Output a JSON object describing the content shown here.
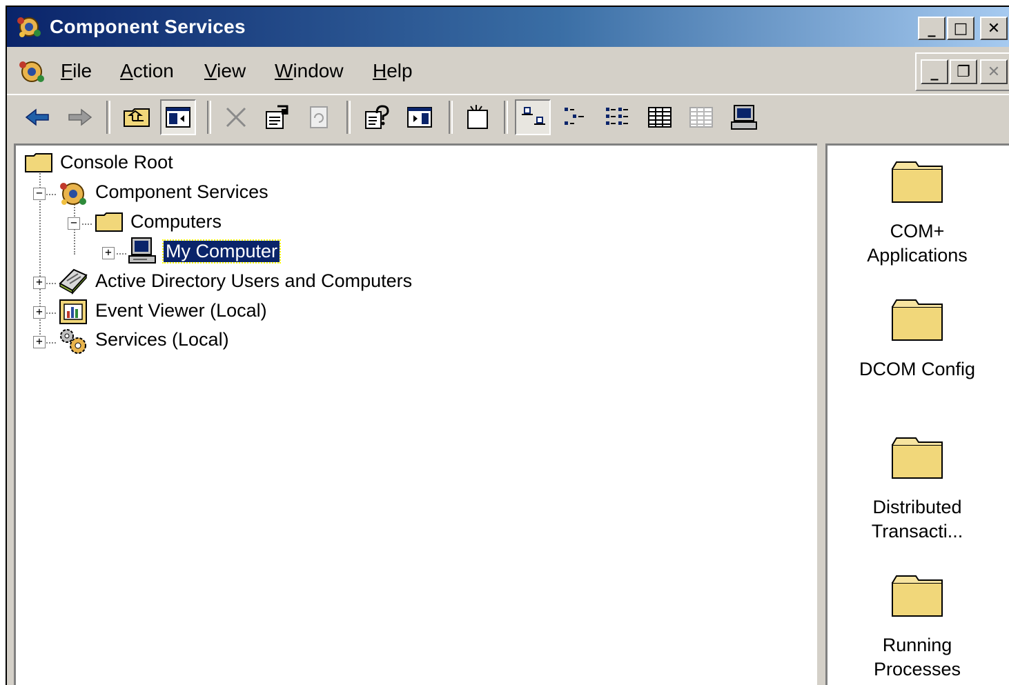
{
  "window": {
    "title": "Component Services"
  },
  "caption_buttons": {
    "minimize": "_",
    "maximize": "□",
    "close": "✕"
  },
  "menu": {
    "items": [
      {
        "label_ul": "F",
        "label_rest": "ile"
      },
      {
        "label_ul": "A",
        "label_rest": "ction"
      },
      {
        "label_ul": "V",
        "label_rest": "iew"
      },
      {
        "label_ul": "W",
        "label_rest": "indow"
      },
      {
        "label_ul": "H",
        "label_rest": "elp"
      }
    ]
  },
  "mdi_buttons": {
    "minimize": "_",
    "restore": "❐",
    "close": "✕"
  },
  "toolbar": {
    "buttons": [
      "back-icon",
      "forward-icon",
      "up-one-level-icon",
      "show-hide-tree-icon",
      "delete-icon",
      "properties-icon",
      "refresh-icon",
      "help-icon",
      "show-hide-action-pane-icon",
      "new-window-icon",
      "large-icons-view-icon",
      "small-icons-view-icon",
      "list-view-icon",
      "detail-view-icon",
      "disabled-view-icon",
      "my-computer-icon"
    ]
  },
  "tree": {
    "root": "Console Root",
    "component_services": "Component Services",
    "computers": "Computers",
    "my_computer": "My Computer",
    "active_directory": "Active Directory Users and Computers",
    "event_viewer": "Event Viewer (Local)",
    "services": "Services (Local)"
  },
  "results": {
    "items": [
      {
        "line1": "COM+",
        "line2": "Applications"
      },
      {
        "line1": "DCOM Config",
        "line2": ""
      },
      {
        "line1": "Distributed",
        "line2": "Transacti..."
      },
      {
        "line1": "Running",
        "line2": "Processes"
      }
    ]
  },
  "colors": {
    "titlebar_start": "#0a246a",
    "titlebar_end": "#a6caf0",
    "selection": "#0a246a",
    "folder": "#f1d77a",
    "chrome": "#d4d0c8"
  }
}
